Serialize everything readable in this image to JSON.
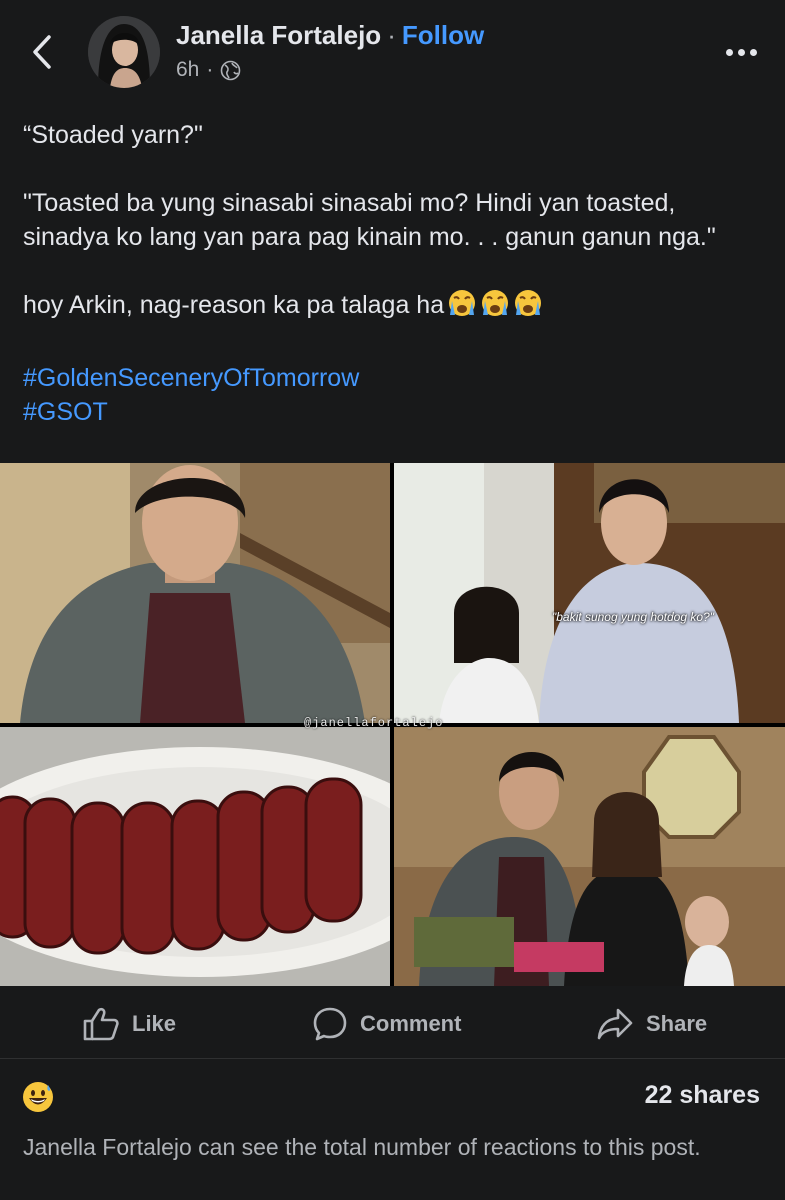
{
  "header": {
    "author": "Janella Fortalejo",
    "separator": "·",
    "follow": "Follow",
    "time": "6h",
    "time_sep": "·",
    "privacy_icon": "globe-icon",
    "back_icon": "chevron-left-icon",
    "more_icon": "more-dots-icon"
  },
  "post": {
    "line1": "“Stoaded yarn?\"",
    "line2": "\"Toasted ba yung sinasabi sinasabi mo? Hindi yan toasted, sinadya ko lang yan para pag kinain mo. . . ganun ganun nga.\"",
    "line3": "hoy Arkin, nag-reason ka pa talaga ha",
    "reaction_emojis": [
      "loudly-crying-face",
      "loudly-crying-face",
      "loudly-crying-face"
    ],
    "hashtags": [
      "#GoldenSeceneryOfTomorrow",
      "#GSOT"
    ]
  },
  "media": {
    "subtitle": "\"bakit sunog yung hotdog ko?\"",
    "watermark": "@janellafortalejo"
  },
  "actions": {
    "like": "Like",
    "comment": "Comment",
    "share": "Share"
  },
  "footer": {
    "reaction_icon": "grinning-sweat-emoji",
    "shares": "22 shares",
    "notice": "Janella Fortalejo can see the total number of reactions to this post."
  },
  "colors": {
    "background": "#18191a",
    "text": "#e4e6eb",
    "secondary": "#b0b3b8",
    "link": "#4599ff"
  }
}
